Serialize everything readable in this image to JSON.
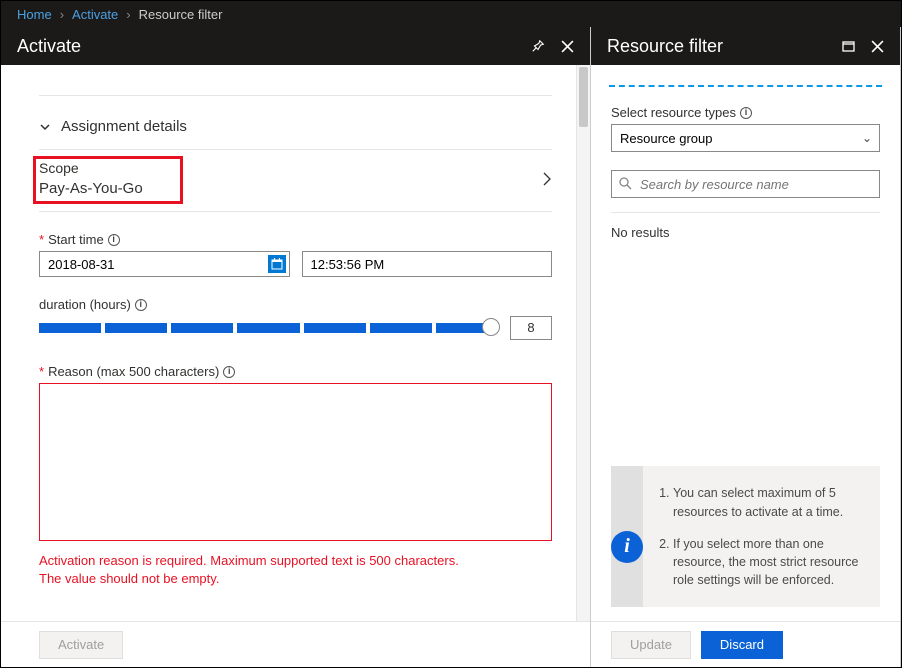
{
  "breadcrumb": [
    "Home",
    "Activate",
    "Resource filter"
  ],
  "left": {
    "title": "Activate",
    "assignmentDetails": "Assignment details",
    "scopeLabel": "Scope",
    "scopeValue": "Pay-As-You-Go",
    "startTimeLabel": "Start time",
    "startDate": "2018-08-31",
    "startTime": "12:53:56 PM",
    "durationLabel": "duration (hours)",
    "durationValue": "8",
    "reasonLabel": "Reason (max 500 characters)",
    "error1": "Activation reason is required. Maximum supported text is 500 characters.",
    "error2": "The value should not be empty.",
    "activateBtn": "Activate"
  },
  "right": {
    "title": "Resource filter",
    "selectTypesLabel": "Select resource types",
    "selectedType": "Resource group",
    "searchPlaceholder": "Search by resource name",
    "noResults": "No results",
    "notice": [
      "You can select maximum of 5 resources to activate at a time.",
      "If you select more than one resource, the most strict resource role settings will be enforced."
    ],
    "updateBtn": "Update",
    "discardBtn": "Discard"
  }
}
